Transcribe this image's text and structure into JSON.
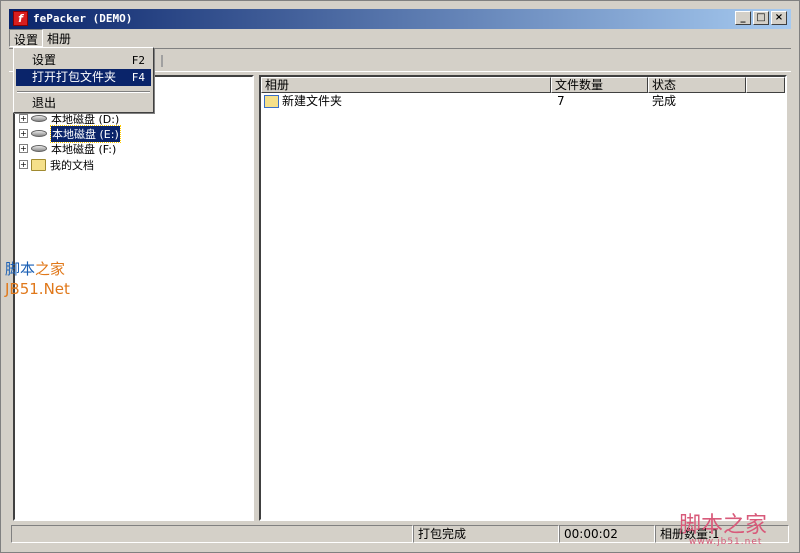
{
  "window": {
    "title": "fePacker (DEMO)",
    "app_icon_glyph": "f",
    "minimize_glyph": "_",
    "maximize_glyph": "□",
    "close_glyph": "×"
  },
  "menubar": {
    "items": [
      {
        "label": "设置"
      },
      {
        "label": "相册"
      }
    ]
  },
  "dropdown": {
    "items": [
      {
        "label": "设置",
        "shortcut": "F2"
      },
      {
        "label": "打开打包文件夹",
        "shortcut": "F4"
      },
      {
        "label": "退出",
        "shortcut": ""
      }
    ]
  },
  "tree": {
    "items": [
      {
        "label": "本地磁盘 (D:)",
        "icon": "disk-icon"
      },
      {
        "label": "本地磁盘 (E:)",
        "icon": "disk-icon",
        "selected": true
      },
      {
        "label": "本地磁盘 (F:)",
        "icon": "disk-icon"
      },
      {
        "label": "我的文档",
        "icon": "folder-icon"
      }
    ],
    "expand_glyph": "+"
  },
  "table": {
    "columns": [
      "相册",
      "文件数量",
      "状态"
    ],
    "rows": [
      {
        "album": "新建文件夹",
        "count": "7",
        "status": "完成"
      }
    ]
  },
  "statusbar": {
    "message": "打包完成",
    "time": "00:00:02",
    "album_count": "相册数量:1"
  },
  "watermark": {
    "left_line1_a": "脚本",
    "left_line1_b": "之家",
    "left_line2": "JB51.Net",
    "right_text": "脚本之家",
    "right_url": "www.jb51.net"
  }
}
